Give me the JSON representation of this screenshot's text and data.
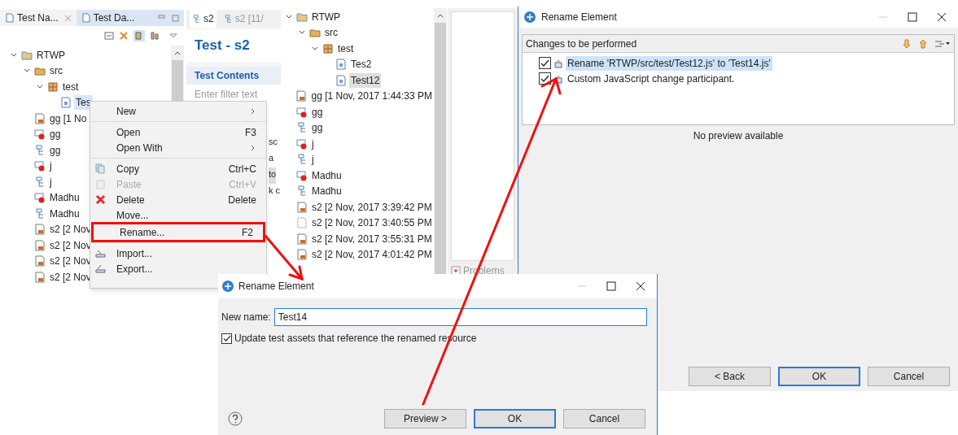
{
  "left_panel": {
    "tabs": [
      {
        "label": "Test Na...",
        "selected": false
      },
      {
        "label": "Test Da...",
        "selected": true
      }
    ],
    "tree": [
      {
        "label": "RTWP",
        "kind": "project",
        "selected": false,
        "children": [
          {
            "label": "src",
            "kind": "folder",
            "selected": false,
            "children": [
              {
                "label": "test",
                "kind": "package",
                "selected": false,
                "children": [
                  {
                    "label": "Tes",
                    "kind": "script",
                    "selected": true
                  }
                ]
              }
            ]
          },
          {
            "label": "gg [1 No",
            "kind": "result",
            "selected": false
          },
          {
            "label": "gg",
            "kind": "test",
            "selected": false
          },
          {
            "label": "gg",
            "kind": "suite",
            "selected": false
          },
          {
            "label": "j",
            "kind": "test",
            "selected": false
          },
          {
            "label": "j",
            "kind": "suite",
            "selected": false
          },
          {
            "label": "Madhu",
            "kind": "test",
            "selected": false
          },
          {
            "label": "Madhu",
            "kind": "suite",
            "selected": false
          },
          {
            "label": "s2 [2 Nov",
            "kind": "result",
            "selected": false
          },
          {
            "label": "s2 [2 Nov",
            "kind": "result",
            "selected": false
          },
          {
            "label": "s2 [2 Nov",
            "kind": "result",
            "selected": false
          },
          {
            "label": "s2 [2 Nov",
            "kind": "result",
            "selected": false
          }
        ]
      }
    ]
  },
  "editor": {
    "tabs": [
      {
        "label": "s2",
        "selected": true
      },
      {
        "label": "s2 [11/",
        "selected": false
      }
    ],
    "title": "Test - s2",
    "section": "Test Contents",
    "filter_placeholder": "Enter filter text",
    "fragments": [
      {
        "text": "sc",
        "selected": false
      },
      {
        "text": "a",
        "selected": false
      },
      {
        "text": "to",
        "selected": true
      },
      {
        "text": "k c",
        "selected": false
      }
    ]
  },
  "context_menu": [
    [
      {
        "label": "New",
        "kind": "plain",
        "submenu": true,
        "disabled": false,
        "annotated": false
      }
    ],
    [
      {
        "label": "Open",
        "kind": "plain",
        "shortcut": "F3",
        "submenu": false,
        "disabled": false,
        "annotated": false
      },
      {
        "label": "Open With",
        "kind": "plain",
        "submenu": true,
        "disabled": false,
        "annotated": false
      }
    ],
    [
      {
        "label": "Copy",
        "kind": "copy",
        "shortcut": "Ctrl+C",
        "submenu": false,
        "disabled": false,
        "annotated": false
      },
      {
        "label": "Paste",
        "kind": "paste",
        "shortcut": "Ctrl+V",
        "submenu": false,
        "disabled": true,
        "annotated": false
      },
      {
        "label": "Delete",
        "kind": "delete",
        "shortcut": "Delete",
        "submenu": false,
        "disabled": false,
        "annotated": false
      },
      {
        "label": "Move...",
        "kind": "plain",
        "submenu": false,
        "disabled": false,
        "annotated": false
      },
      {
        "label": "Rename...",
        "kind": "plain",
        "shortcut": "F2",
        "submenu": false,
        "disabled": false,
        "annotated": true
      }
    ],
    [
      {
        "label": "Import...",
        "kind": "import",
        "submenu": false,
        "disabled": false,
        "annotated": false
      },
      {
        "label": "Export...",
        "kind": "export",
        "submenu": false,
        "disabled": false,
        "annotated": false
      }
    ]
  ],
  "middle_panel": {
    "tree": [
      {
        "label": "RTWP",
        "kind": "project",
        "selected": false,
        "children": [
          {
            "label": "src",
            "kind": "folder",
            "selected": false,
            "children": [
              {
                "label": "test",
                "kind": "package",
                "selected": false,
                "children": [
                  {
                    "label": "Tes2",
                    "kind": "script",
                    "selected": false
                  },
                  {
                    "label": "Test12",
                    "kind": "script",
                    "selected": true
                  }
                ]
              }
            ]
          }
        ]
      },
      {
        "label": "gg [1 Nov, 2017 1:44:33 PM",
        "kind": "result",
        "selected": false
      },
      {
        "label": "gg",
        "kind": "test",
        "selected": false
      },
      {
        "label": "gg",
        "kind": "suite",
        "selected": false
      },
      {
        "label": "j",
        "kind": "test",
        "selected": false
      },
      {
        "label": "j",
        "kind": "suite",
        "selected": false
      },
      {
        "label": "Madhu",
        "kind": "test",
        "selected": false
      },
      {
        "label": "Madhu",
        "kind": "suite",
        "selected": false
      },
      {
        "label": "s2 [2 Nov, 2017 3:39:42 PM",
        "kind": "result",
        "selected": false
      },
      {
        "label": "s2 [2 Nov, 2017 3:40:55 PM",
        "kind": "blank",
        "selected": false
      },
      {
        "label": "s2 [2 Nov, 2017 3:55:31 PM",
        "kind": "result",
        "selected": false
      },
      {
        "label": "s2 [2 Nov, 2017 4:01:42 PM",
        "kind": "result",
        "selected": false
      }
    ],
    "problems_tab": "Problems"
  },
  "preview_dialog": {
    "title": "Rename Element",
    "section": "Changes to be performed",
    "changes": [
      {
        "label": "Rename 'RTWP/src/test/Test12.js' to 'Test14.js'",
        "checked": true,
        "selected": true
      },
      {
        "label": "Custom JavaScript change participant.",
        "checked": true,
        "selected": false
      }
    ],
    "preview_message": "No preview available",
    "buttons": [
      {
        "label": "< Back",
        "default": false
      },
      {
        "label": "OK",
        "default": true
      },
      {
        "label": "Cancel",
        "default": false
      }
    ]
  },
  "rename_dialog": {
    "title": "Rename Element",
    "field_label": "New name:",
    "value": "Test14",
    "checkbox": {
      "label": "Update test assets that reference the renamed resource",
      "checked": true
    },
    "buttons": [
      {
        "label": "Preview >",
        "default": false
      },
      {
        "label": "OK",
        "default": true
      },
      {
        "label": "Cancel",
        "default": false
      }
    ]
  }
}
